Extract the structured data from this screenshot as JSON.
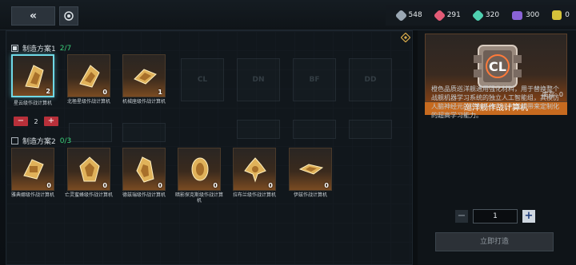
{
  "topbar": {
    "back_label": "«",
    "resources": [
      {
        "icon": "crystal-icon",
        "color": "#9aa7b3",
        "value": "548"
      },
      {
        "icon": "red-gem-icon",
        "color": "#e35b76",
        "value": "291"
      },
      {
        "icon": "green-gem-icon",
        "color": "#4fd0b0",
        "value": "320"
      },
      {
        "icon": "purple-gem-icon",
        "color": "#8a63d6",
        "value": "300"
      },
      {
        "icon": "gold-cube-icon",
        "color": "#d4c23a",
        "value": "0"
      }
    ]
  },
  "plan1": {
    "label": "制造方案1",
    "progress": "2/7",
    "checked": true,
    "items": [
      {
        "label": "星云级作战计算机",
        "count": "2"
      },
      {
        "label": "北極星级作战计算机",
        "count": "0"
      },
      {
        "label": "机械座级作战计算机",
        "count": "1"
      }
    ],
    "stepper_value": "2",
    "minus": "−",
    "plus": "+"
  },
  "plan2": {
    "label": "制造方案2",
    "progress": "0/3",
    "checked": false,
    "items": [
      {
        "label": "雅典娜级作战计算机",
        "count": "0"
      },
      {
        "label": "亡灵蜜蜂级作战计算机",
        "count": "0"
      },
      {
        "label": "德兹瑞级作战计算机",
        "count": "0"
      },
      {
        "label": "暗影探克斯级作战计算机",
        "count": "0"
      },
      {
        "label": "拉布兰级作战计算机",
        "count": "0"
      },
      {
        "label": "伊兹作战计算机",
        "count": "0"
      }
    ]
  },
  "detail": {
    "title": "巡洋舰作战计算机",
    "stock": "库存: 0",
    "description": "橙色品质巡洋舰通用强化材料，用于替换整个战舰机器学习系统的独立人工智能组，其模仿人脑神经元的控制系统可以为战舰带来定制化的超高学习能力。",
    "quantity": "1",
    "minus": "−",
    "plus": "+",
    "build_label": "立即打造"
  }
}
